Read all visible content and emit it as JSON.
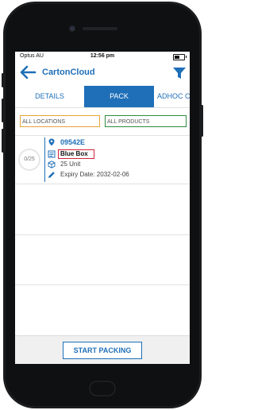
{
  "status_bar": {
    "carrier": "Optus AU",
    "time": "12:56 pm"
  },
  "app_bar": {
    "title": "CartonCloud"
  },
  "tabs": [
    {
      "label": "DETAILS",
      "active": false
    },
    {
      "label": "PACK",
      "active": true
    },
    {
      "label": "ADHOC C",
      "active": false
    }
  ],
  "filters": {
    "locations": "ALL LOCATIONS",
    "products": "ALL PRODUCTS"
  },
  "items": [
    {
      "progress": "0/25",
      "location": "09542E",
      "product": "Blue Box",
      "quantity": "25 Unit",
      "expiry": "Expiry Date: 2032-02-06"
    }
  ],
  "footer": {
    "start_label": "START PACKING"
  },
  "colors": {
    "primary": "#1e6fb8",
    "locations_border": "#e8a23a",
    "products_border": "#2e8b3e",
    "highlight": "#d0253a"
  }
}
